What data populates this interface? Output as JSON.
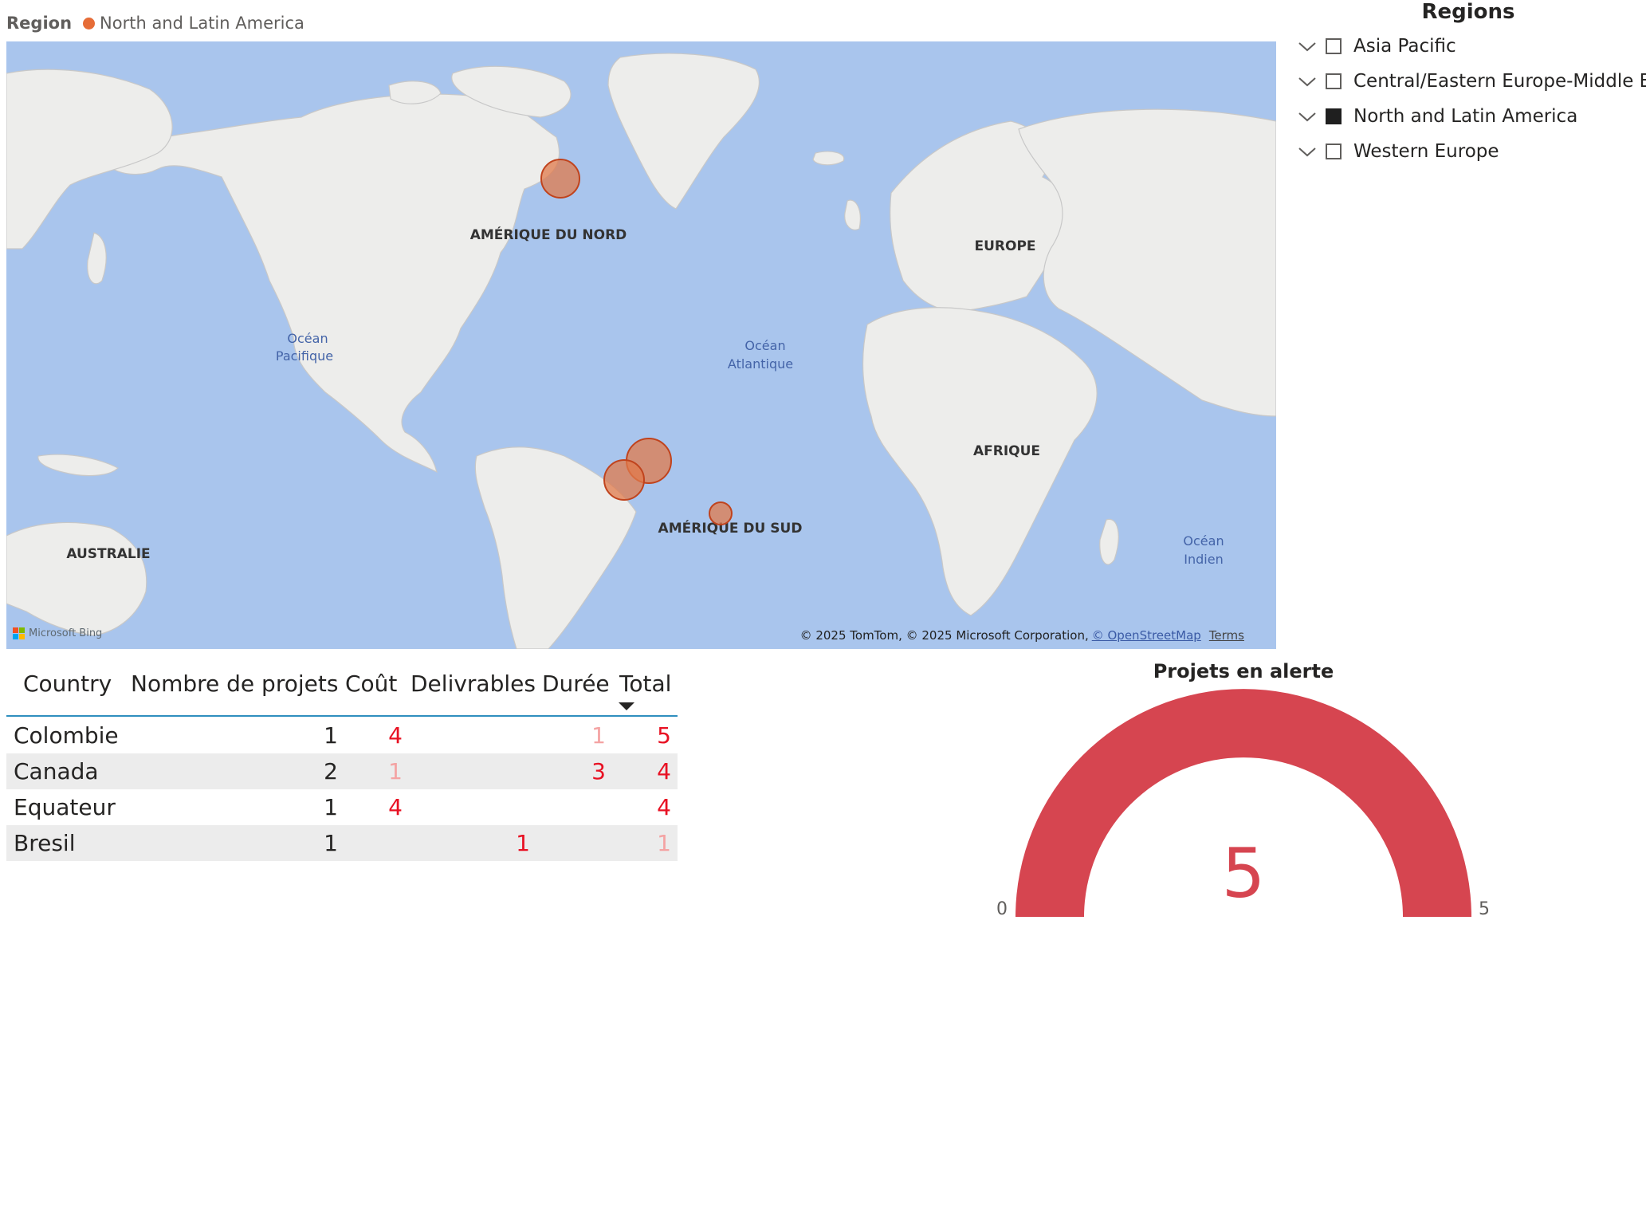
{
  "map": {
    "legend_title": "Region",
    "legend_item": "North and Latin America",
    "legend_color": "#e66c37",
    "water_color": "#a9c5ed",
    "land_color": "#ededeb",
    "labels": {
      "north_america": "AMÉRIQUE DU NORD",
      "europe": "EUROPE",
      "africa": "AFRIQUE",
      "south_america": "AMÉRIQUE DU SUD",
      "australia": "AUSTRALIE",
      "pacific_1": "Océan",
      "pacific_2": "Pacifique",
      "atlantic_1": "Océan",
      "atlantic_2": "Atlantique",
      "indian_1": "Océan",
      "indian_2": "Indien"
    },
    "bing_logo": "Microsoft Bing",
    "attribution": "© 2025 TomTom, © 2025 Microsoft Corporation,",
    "attribution_link": "© OpenStreetMap",
    "terms": "Terms"
  },
  "slicer": {
    "title": "Regions",
    "items": [
      {
        "label": "Asia Pacific",
        "checked": false
      },
      {
        "label": "Central/Eastern Europe-Middle E...",
        "checked": false
      },
      {
        "label": "North and Latin America",
        "checked": true
      },
      {
        "label": "Western Europe",
        "checked": false
      }
    ]
  },
  "table": {
    "headers": {
      "country": "Country",
      "projects": "Nombre de projets",
      "cost": "Coût",
      "deliverables": "Delivrables",
      "duration": "Durée",
      "total": "Total"
    },
    "sorted_column": "Total",
    "rows": [
      {
        "country": "Colombie",
        "projects": "1",
        "cost": "4",
        "deliverables": "",
        "duration": "1",
        "total": "5"
      },
      {
        "country": "Canada",
        "projects": "2",
        "cost": "1",
        "deliverables": "",
        "duration": "3",
        "total": "4"
      },
      {
        "country": "Equateur",
        "projects": "1",
        "cost": "4",
        "deliverables": "",
        "duration": "",
        "total": "4"
      },
      {
        "country": "Bresil",
        "projects": "1",
        "cost": "",
        "deliverables": "1",
        "duration": "",
        "total": "1"
      }
    ]
  },
  "gauge": {
    "title": "Projets en alerte",
    "value": "5",
    "min": "0",
    "max": "5",
    "color": "#d64550"
  }
}
